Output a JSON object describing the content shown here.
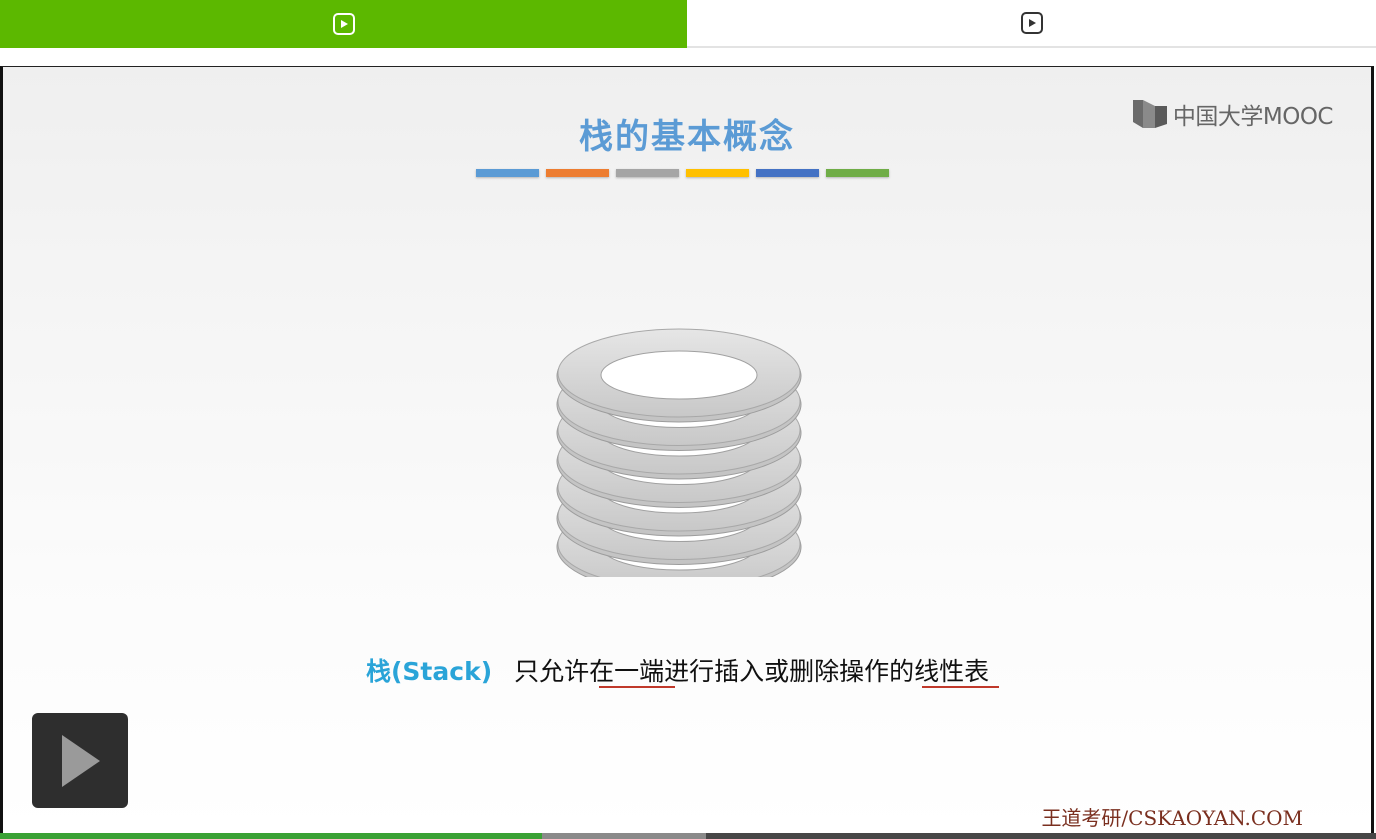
{
  "tabs": {
    "active": {
      "icon": "play-icon",
      "color": "#5cb800"
    },
    "inactive": {
      "icon": "play-icon"
    }
  },
  "slide": {
    "title": "栈的基本概念",
    "title_color": "#5b9bd5",
    "color_bars": [
      "#5b9bd5",
      "#ed7d31",
      "#a5a5a5",
      "#ffc000",
      "#4472c4",
      "#70ad47"
    ],
    "logo_text": "中国大学MOOC",
    "illustration": "stacked-plates",
    "definition": {
      "term": "栈(Stack)",
      "text": "只允许在一端进行插入或删除操作的线性表",
      "term_color": "#2aa4d8",
      "underline_color": "#c0392b"
    },
    "watermark": "王道考研/CSKAOYAN.COM"
  },
  "player": {
    "big_play_icon": "play-icon",
    "progress_fraction": 0.394,
    "buffered_fraction": 0.513,
    "progress_color": "#3aa135"
  }
}
